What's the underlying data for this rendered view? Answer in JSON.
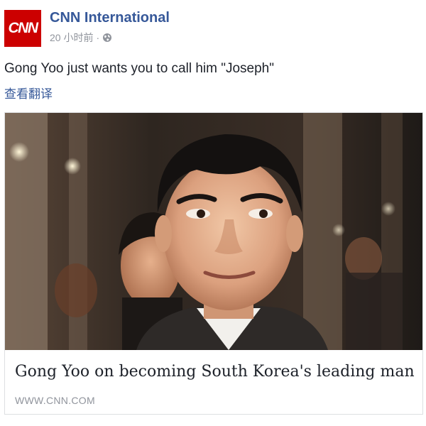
{
  "page": {
    "name": "CNN International",
    "logo_text": "CNN",
    "timestamp": "20 小时前",
    "separator": "·",
    "privacy_icon": "globe-icon"
  },
  "post": {
    "text": "Gong Yoo just wants you to call him \"Joseph\"",
    "translate_label": "查看翻译"
  },
  "link_card": {
    "image_subject": "photo",
    "title": "Gong Yoo on becoming South Korea's leading man",
    "domain": "WWW.CNN.COM"
  },
  "colors": {
    "brand_red": "#cc0000",
    "link_blue": "#365899",
    "meta_gray": "#90949c"
  }
}
